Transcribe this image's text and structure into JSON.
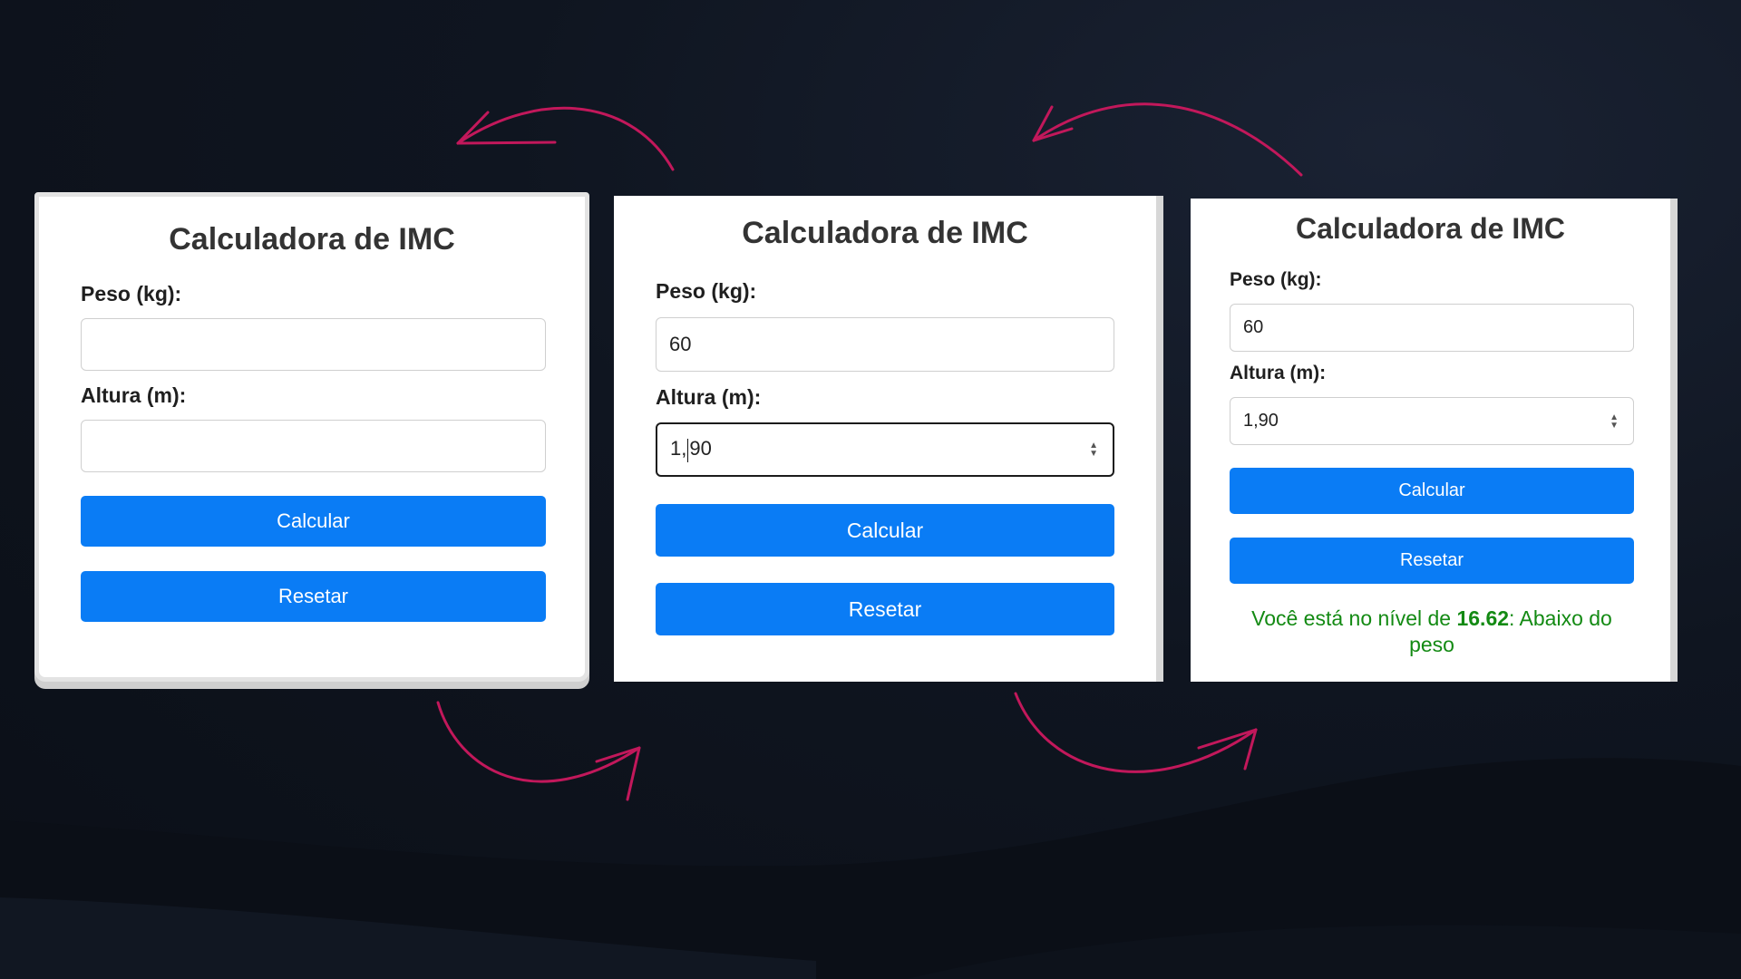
{
  "colors": {
    "background": "#0f1520",
    "card": "#ffffff",
    "button": "#0a7cf5",
    "result_text": "#138a13",
    "arrow": "#c2185b"
  },
  "icons": {
    "arrow": "curved-arrow-icon",
    "spinner": "spinner-arrows-icon"
  },
  "panels": [
    {
      "title": "Calculadora de IMC",
      "peso_label": "Peso (kg):",
      "peso_value": "",
      "altura_label": "Altura (m):",
      "altura_value": "",
      "calcular_label": "Calcular",
      "resetar_label": "Resetar"
    },
    {
      "title": "Calculadora de IMC",
      "peso_label": "Peso (kg):",
      "peso_value": "60",
      "altura_label": "Altura (m):",
      "altura_value_before_caret": "1,",
      "altura_value_after_caret": "90",
      "calcular_label": "Calcular",
      "resetar_label": "Resetar"
    },
    {
      "title": "Calculadora de IMC",
      "peso_label": "Peso (kg):",
      "peso_value": "60",
      "altura_label": "Altura (m):",
      "altura_value": "1,90",
      "calcular_label": "Calcular",
      "resetar_label": "Resetar",
      "result_prefix": "Você está no nível de ",
      "result_value": "16.62",
      "result_suffix": ": Abaixo do peso"
    }
  ]
}
